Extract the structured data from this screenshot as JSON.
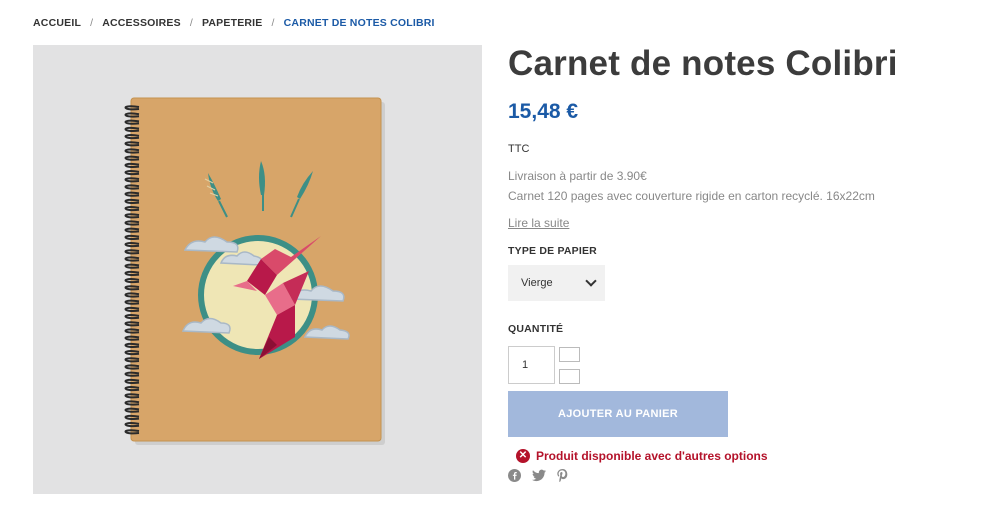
{
  "breadcrumb": {
    "items": [
      "ACCUEIL",
      "ACCESSOIRES",
      "PAPETERIE"
    ],
    "separator": "/",
    "current": "CARNET DE NOTES COLIBRI"
  },
  "product": {
    "title": "Carnet de notes Colibri",
    "price": "15,48 €",
    "tax_label": "TTC",
    "delivery": "Livraison à partir de 3.90€",
    "description": "Carnet 120 pages avec couverture rigide en carton recyclé. 16x22cm",
    "read_more": "Lire la suite"
  },
  "options": {
    "paper_label": "TYPE DE PAPIER",
    "paper_value": "Vierge",
    "quantity_label": "QUANTITÉ",
    "quantity_value": "1"
  },
  "actions": {
    "add_to_cart": "AJOUTER AU PANIER"
  },
  "availability": {
    "message": "Produit disponible avec d'autres options",
    "color": "#b4122a"
  },
  "social": [
    "facebook-icon",
    "twitter-icon",
    "pinterest-icon"
  ],
  "colors": {
    "accent": "#1b5aa6",
    "button": "#a2b8dc",
    "kraft": "#d7a569"
  }
}
